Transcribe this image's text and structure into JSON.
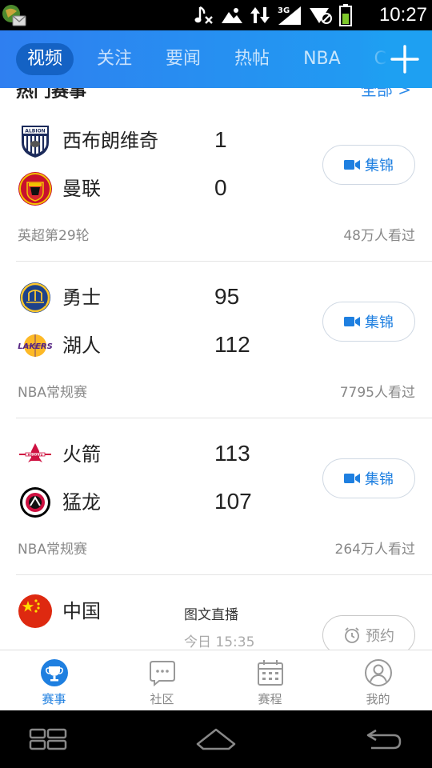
{
  "status_bar": {
    "time": "10:27",
    "network": "3G",
    "icons": [
      "app-notification-icon",
      "music-mute-icon",
      "picture-icon",
      "data-transfer-icon",
      "signal-3g-icon",
      "wifi-off-icon",
      "battery-icon"
    ]
  },
  "top_nav": {
    "tabs": [
      {
        "label": "视频",
        "active": true
      },
      {
        "label": "关注",
        "active": false
      },
      {
        "label": "要闻",
        "active": false
      },
      {
        "label": "热帖",
        "active": false
      },
      {
        "label": "NBA",
        "active": false
      },
      {
        "label": "C",
        "active": false
      }
    ],
    "add_icon": "plus-icon"
  },
  "section": {
    "title": "热门赛事",
    "more": "全部 >"
  },
  "matches": [
    {
      "home": {
        "name": "西布朗维奇",
        "score": "1",
        "logo": "west-brom-logo"
      },
      "away": {
        "name": "曼联",
        "score": "0",
        "logo": "man-utd-logo"
      },
      "league": "英超第29轮",
      "views": "48万人看过",
      "action": {
        "label": "集锦",
        "icon": "video-camera-icon"
      }
    },
    {
      "home": {
        "name": "勇士",
        "score": "95",
        "logo": "warriors-logo"
      },
      "away": {
        "name": "湖人",
        "score": "112",
        "logo": "lakers-logo"
      },
      "league": "NBA常规赛",
      "views": "7795人看过",
      "action": {
        "label": "集锦",
        "icon": "video-camera-icon"
      }
    },
    {
      "home": {
        "name": "火箭",
        "score": "113",
        "logo": "rockets-logo"
      },
      "away": {
        "name": "猛龙",
        "score": "107",
        "logo": "raptors-logo"
      },
      "league": "NBA常规赛",
      "views": "264万人看过",
      "action": {
        "label": "集锦",
        "icon": "video-camera-icon"
      }
    },
    {
      "home": {
        "name": "中国",
        "score": "",
        "logo": "china-flag"
      },
      "live_label": "图文直播",
      "live_time": "今日 15:35",
      "action": {
        "label": "预约",
        "icon": "alarm-clock-icon"
      }
    }
  ],
  "bottom_tabs": [
    {
      "label": "赛事",
      "icon": "trophy-icon",
      "active": true
    },
    {
      "label": "社区",
      "icon": "chat-bubble-icon",
      "active": false
    },
    {
      "label": "赛程",
      "icon": "calendar-icon",
      "active": false
    },
    {
      "label": "我的",
      "icon": "profile-icon",
      "active": false
    }
  ],
  "colors": {
    "nav_start": "#2f7ff0",
    "nav_end": "#1ea0f2",
    "active_pill": "#1462c4",
    "accent": "#1e7fe0"
  }
}
